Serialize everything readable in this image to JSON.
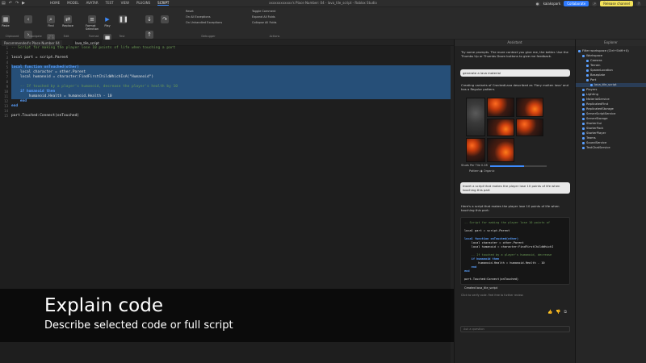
{
  "window": {
    "title": "xxxxxxxxxxxx's Place Number: 04 - lava_tile_script - Roblox Studio"
  },
  "menu": {
    "tabs": [
      "HOME",
      "MODEL",
      "AVATAR",
      "TEST",
      "VIEW",
      "PLUGINS",
      "SCRIPT"
    ],
    "active_tab": "SCRIPT"
  },
  "top_right": {
    "user": "kaiakspark",
    "collaborate": "Collaborate",
    "release": "Release channel"
  },
  "ribbon": {
    "clipboard_label": "Clipboard",
    "navigate_label": "Navigate",
    "edit_label": "Edit",
    "format_label": "Format",
    "test_label": "Test",
    "debugger_label": "Debugger",
    "actions_label": "Actions",
    "btn_paste": "Paste",
    "btn_find": "Find",
    "btn_replace": "Replace",
    "btn_select": "Select",
    "btn_format": "Format Selection",
    "btn_play": "Play",
    "btn_run": "Run",
    "btn_stop": "Stop",
    "debug_items": [
      "Reset",
      "On All Exceptions",
      "On Unhandled Exceptions"
    ],
    "action_items": [
      "Toggle Comment",
      "Expand All Folds",
      "Collapse All Folds"
    ]
  },
  "tabs": {
    "recommended": "Recommended's Place Number 04",
    "active_script": "lava_tile_script"
  },
  "editor": {
    "gutter": [
      "1",
      "2",
      "3",
      "4",
      "5",
      "6",
      "7",
      "8",
      "9",
      "10",
      "11",
      "12",
      "13",
      "14",
      "15"
    ],
    "lines": [
      {
        "t": "-- Script for making the player lose 10 points of life when touching a part",
        "c": "comment",
        "sel": false
      },
      {
        "t": "",
        "c": "ident",
        "sel": false
      },
      {
        "t": "local part = script.Parent",
        "c": "ident",
        "sel": false
      },
      {
        "t": "",
        "c": "ident",
        "sel": false
      },
      {
        "t": "local function onTouched(other)",
        "c": "kw",
        "sel": true
      },
      {
        "t": "    local character = other.Parent",
        "c": "ident",
        "sel": true
      },
      {
        "t": "    local humanoid = character:FindFirstChildWhichIsA(\"Humanoid\")",
        "c": "ident",
        "sel": true
      },
      {
        "t": "",
        "c": "ident",
        "sel": true
      },
      {
        "t": "    -- If touched by a player's humanoid, decrease the player's health by 10",
        "c": "comment",
        "sel": true
      },
      {
        "t": "    if humanoid then",
        "c": "kw",
        "sel": true
      },
      {
        "t": "        humanoid.Health = humanoid.Health - 10",
        "c": "ident",
        "sel": true
      },
      {
        "t": "    end",
        "c": "kw",
        "sel": false
      },
      {
        "t": "end",
        "c": "kw",
        "sel": false
      },
      {
        "t": "",
        "c": "ident",
        "sel": false
      },
      {
        "t": "part.Touched:Connect(onTouched)",
        "c": "ident",
        "sel": false
      }
    ]
  },
  "caption": {
    "title": "Explain code",
    "subtitle": "Describe selected code or full script"
  },
  "assistant": {
    "title": "Assistant",
    "intro": "Try some prompts. The more context you give me, the better. Use the Thumbs Up or Thumbs Down buttons to give me feedback.",
    "user_msg_1": "generate a lava material",
    "reply_1": "Creating variants of CrackedLava described as 'Fiery molten lava' and has a Regular pattern.",
    "studs_label": "Studs Per Tile",
    "studs_value": "0.28",
    "pattern_label": "Pattern",
    "pattern_value": "Organic",
    "user_msg_2": "Insert a script that makes the player lose 10 points of life when touching this part",
    "reply_2": "Here's a script that makes the player lose 10 points of life when touching this part:",
    "code_lines": [
      {
        "t": "-- Script for making the player lose 10 points of",
        "c": "comment"
      },
      {
        "t": "",
        "c": "ident"
      },
      {
        "t": "local part = script.Parent",
        "c": "ident"
      },
      {
        "t": "",
        "c": "ident"
      },
      {
        "t": "local function onTouched(other)",
        "c": "kw"
      },
      {
        "t": "    local character = other.Parent",
        "c": "ident"
      },
      {
        "t": "    local humanoid = character:FindFirstChildWhichI",
        "c": "ident"
      },
      {
        "t": "",
        "c": "ident"
      },
      {
        "t": "    -- If touched by a player's humanoid, decrease",
        "c": "comment"
      },
      {
        "t": "    if humanoid then",
        "c": "kw"
      },
      {
        "t": "        humanoid.Health = humanoid.Health - 10",
        "c": "ident"
      },
      {
        "t": "    end",
        "c": "kw"
      },
      {
        "t": "end",
        "c": "kw"
      },
      {
        "t": "",
        "c": "ident"
      },
      {
        "t": "part.Touched:Connect(onTouched)",
        "c": "ident"
      }
    ],
    "created": "Created lava_tile_script",
    "footnote": "Click to verify code. Feel free to further review.",
    "input_placeholder": "Ask a question"
  },
  "explorer": {
    "title": "Explorer",
    "items": [
      {
        "label": "Filter workspace (Ctrl+Shift+X)",
        "indent": 0,
        "sel": false
      },
      {
        "label": "Workspace",
        "indent": 1,
        "sel": false
      },
      {
        "label": "Camera",
        "indent": 2,
        "sel": false
      },
      {
        "label": "Terrain",
        "indent": 2,
        "sel": false
      },
      {
        "label": "SpawnLocation",
        "indent": 2,
        "sel": false
      },
      {
        "label": "Baseplate",
        "indent": 2,
        "sel": false
      },
      {
        "label": "Part",
        "indent": 2,
        "sel": false
      },
      {
        "label": "lava_tile_script",
        "indent": 3,
        "sel": true
      },
      {
        "label": "Players",
        "indent": 1,
        "sel": false
      },
      {
        "label": "Lighting",
        "indent": 1,
        "sel": false
      },
      {
        "label": "MaterialService",
        "indent": 1,
        "sel": false
      },
      {
        "label": "ReplicatedFirst",
        "indent": 1,
        "sel": false
      },
      {
        "label": "ReplicatedStorage",
        "indent": 1,
        "sel": false
      },
      {
        "label": "ServerScriptService",
        "indent": 1,
        "sel": false
      },
      {
        "label": "ServerStorage",
        "indent": 1,
        "sel": false
      },
      {
        "label": "StarterGui",
        "indent": 1,
        "sel": false
      },
      {
        "label": "StarterPack",
        "indent": 1,
        "sel": false
      },
      {
        "label": "StarterPlayer",
        "indent": 1,
        "sel": false
      },
      {
        "label": "Teams",
        "indent": 1,
        "sel": false
      },
      {
        "label": "SoundService",
        "indent": 1,
        "sel": false
      },
      {
        "label": "TextChatService",
        "indent": 1,
        "sel": false
      }
    ]
  }
}
